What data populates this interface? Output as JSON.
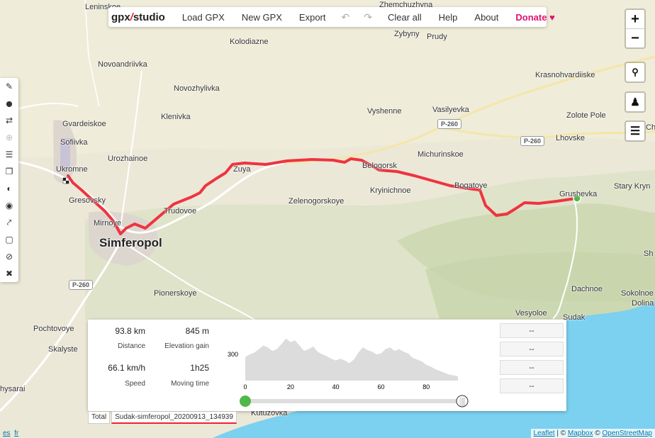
{
  "menu": {
    "logo_left": "gpx",
    "logo_slash": "/",
    "logo_right": "studio",
    "load": "Load GPX",
    "new": "New GPX",
    "export": "Export",
    "undo": "↶",
    "redo": "↷",
    "clear": "Clear all",
    "help": "Help",
    "about": "About",
    "donate": "Donate",
    "heart": "♥"
  },
  "zoom": {
    "in": "+",
    "out": "−"
  },
  "right_controls": {
    "search": "🔍",
    "locate": "♟",
    "layers": "☰"
  },
  "toolbar": [
    {
      "icon": "pencil-icon",
      "glyph": "✎"
    },
    {
      "icon": "bottle-icon",
      "glyph": "⬤"
    },
    {
      "icon": "reverse-icon",
      "glyph": "⇄"
    },
    {
      "icon": "add-circle-icon",
      "glyph": "⊕"
    },
    {
      "icon": "list-icon",
      "glyph": "☰"
    },
    {
      "icon": "copy-icon",
      "glyph": "❐"
    },
    {
      "icon": "palette-icon",
      "glyph": "◐"
    },
    {
      "icon": "marker-icon",
      "glyph": "◉"
    },
    {
      "icon": "reduce-icon",
      "glyph": "⤤"
    },
    {
      "icon": "crop-icon",
      "glyph": "▢"
    },
    {
      "icon": "hide-icon",
      "glyph": "⊘"
    },
    {
      "icon": "trash-icon",
      "glyph": "✖"
    }
  ],
  "places": [
    {
      "name": "Leninskoe",
      "big": false
    },
    {
      "name": "Zhemchuzhyna",
      "big": false
    },
    {
      "name": "Zybyny",
      "big": false
    },
    {
      "name": "Prudy",
      "big": false
    },
    {
      "name": "Kolodiazne",
      "big": false
    },
    {
      "name": "Novoandriivka",
      "big": false
    },
    {
      "name": "Krasnohvardiiske",
      "big": false
    },
    {
      "name": "Novozhylivka",
      "big": false
    },
    {
      "name": "Vyshenne",
      "big": false
    },
    {
      "name": "Vasilyevka",
      "big": false
    },
    {
      "name": "Zolote Pole",
      "big": false
    },
    {
      "name": "Klenivka",
      "big": false
    },
    {
      "name": "Gvardeiskoe",
      "big": false
    },
    {
      "name": "Lhovske",
      "big": false
    },
    {
      "name": "Sofiivka",
      "big": false
    },
    {
      "name": "Michurinskoe",
      "big": false
    },
    {
      "name": "Urozhainoe",
      "big": false
    },
    {
      "name": "Ukromne",
      "big": false
    },
    {
      "name": "Zuya",
      "big": false
    },
    {
      "name": "Belogorsk",
      "big": false
    },
    {
      "name": "Kryinichnoe",
      "big": false
    },
    {
      "name": "Bogatoye",
      "big": false
    },
    {
      "name": "Grushevka",
      "big": false
    },
    {
      "name": "Stary Kryn",
      "big": false
    },
    {
      "name": "Gresovsky",
      "big": false
    },
    {
      "name": "Zelenogorskoye",
      "big": false
    },
    {
      "name": "Trudovoe",
      "big": false
    },
    {
      "name": "Mirnoye",
      "big": false
    },
    {
      "name": "Simferopol",
      "big": true
    },
    {
      "name": "Pionerskoye",
      "big": false
    },
    {
      "name": "Dachnoe",
      "big": false
    },
    {
      "name": "Sudak",
      "big": false
    },
    {
      "name": "Vesyoloe",
      "big": false
    },
    {
      "name": "Sokolnoe",
      "big": false
    },
    {
      "name": "Dolina",
      "big": false
    },
    {
      "name": "Pochtovoye",
      "big": false
    },
    {
      "name": "Skalyste",
      "big": false
    },
    {
      "name": "hysarai",
      "big": false
    },
    {
      "name": "Kutuzovka",
      "big": false
    },
    {
      "name": "Ch",
      "big": false
    },
    {
      "name": "Sh",
      "big": false
    }
  ],
  "roads": [
    "P-260",
    "P-260",
    "P-260"
  ],
  "stats": {
    "distance_value": "93.8 km",
    "distance_label": "Distance",
    "elevation_value": "845 m",
    "elevation_label": "Elevation gain",
    "speed_value": "66.1 km/h",
    "speed_label": "Speed",
    "moving_value": "1h25",
    "moving_label": "Moving time"
  },
  "chart_data": {
    "type": "area",
    "xlabel": "",
    "ylabel": "",
    "xticks": [
      "0",
      "20",
      "40",
      "60",
      "80"
    ],
    "yticks": [
      "300"
    ],
    "xlim": [
      0,
      94
    ],
    "ylim": [
      0,
      600
    ],
    "color": "#dcdcdc",
    "x": [
      0,
      2,
      4,
      6,
      8,
      10,
      12,
      14,
      16,
      18,
      20,
      22,
      24,
      26,
      28,
      30,
      32,
      34,
      36,
      38,
      40,
      42,
      44,
      46,
      48,
      50,
      52,
      54,
      56,
      58,
      60,
      62,
      64,
      66,
      68,
      70,
      72,
      74,
      76,
      78,
      80,
      82,
      84,
      86,
      88,
      90,
      92,
      94
    ],
    "values": [
      270,
      300,
      320,
      360,
      400,
      380,
      340,
      360,
      420,
      480,
      440,
      460,
      400,
      340,
      360,
      390,
      330,
      300,
      280,
      250,
      230,
      250,
      230,
      200,
      240,
      320,
      380,
      350,
      330,
      300,
      310,
      360,
      380,
      340,
      360,
      330,
      310,
      260,
      240,
      220,
      180,
      160,
      130,
      110,
      90,
      70,
      60,
      50
    ]
  },
  "tabs": [
    "Total",
    "Sudak-simferopol_20200913_134939"
  ],
  "dash_values": [
    "--",
    "--",
    "--",
    "--"
  ],
  "attribution": {
    "leaflet": "Leaflet",
    "sep1": " | © ",
    "mapbox": "Mapbox",
    "sep2": " © ",
    "osm": "OpenStreetMap"
  },
  "langs": {
    "es": "es",
    "fr": "fr"
  },
  "colors": {
    "track": "#ef3340",
    "start": "#50b848",
    "donate": "#e0116e",
    "sea": "#7cd0f0"
  }
}
